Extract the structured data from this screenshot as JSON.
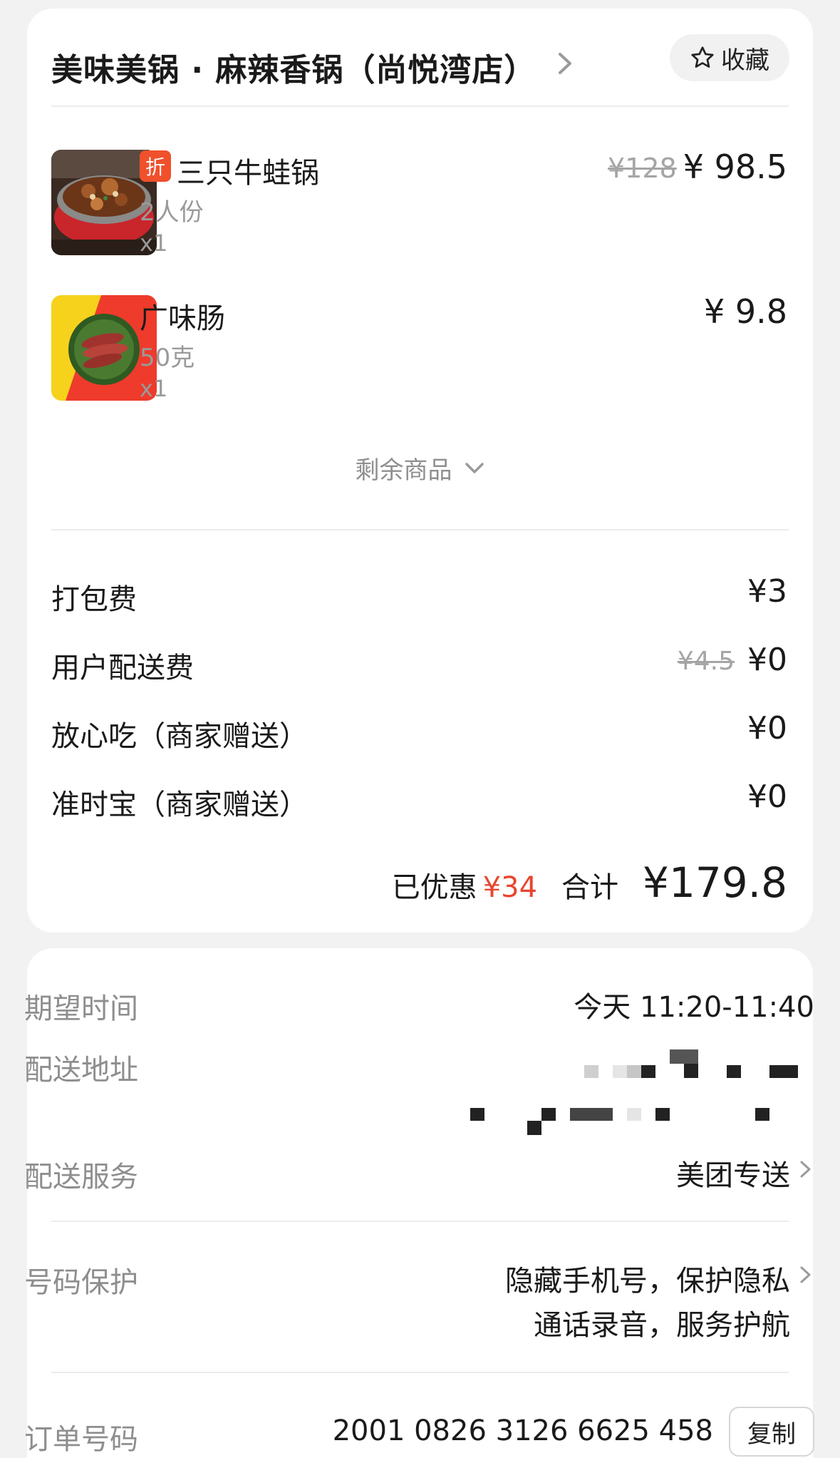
{
  "header": {
    "store_name": "美味美锅 · 麻辣香锅（尚悦湾店）",
    "favorite_label": "收藏"
  },
  "items": [
    {
      "badge": "折",
      "name": "三只牛蛙锅",
      "spec": "2人份",
      "qty": "x1",
      "original_price": "¥128",
      "price": "¥ 98.5",
      "image": "frog-hotpot-photo"
    },
    {
      "name": "广味肠",
      "spec": "50克",
      "qty": "x1",
      "price": "¥ 9.8",
      "image": "sausage-photo"
    }
  ],
  "more_items_label": "剩余商品",
  "fees": [
    {
      "label": "打包费",
      "value": "¥3"
    },
    {
      "label": "用户配送费",
      "original": "¥4.5",
      "value": "¥0"
    },
    {
      "label": "放心吃（商家赠送）",
      "value": "¥0"
    },
    {
      "label": "准时宝（商家赠送）",
      "value": "¥0"
    }
  ],
  "summary": {
    "discount_label": "已优惠",
    "discount_value": "¥34",
    "total_label": "合计",
    "total_value": "¥179.8"
  },
  "delivery": {
    "expected_time_label": "期望时间",
    "expected_time_value": "今天 11:20-11:40",
    "address_label": "配送地址",
    "service_label": "配送服务",
    "service_value": "美团专送",
    "privacy_label": "号码保护",
    "privacy_line1": "隐藏手机号，保护隐私",
    "privacy_line2": "通话录音，服务护航",
    "order_label": "订单号码",
    "order_value": "2001 0826 3126 6625 458",
    "copy_label": "复制"
  },
  "colors": {
    "accent_red": "#e8462f",
    "badge_orange": "#f0502b",
    "background": "#f2f2f2"
  }
}
